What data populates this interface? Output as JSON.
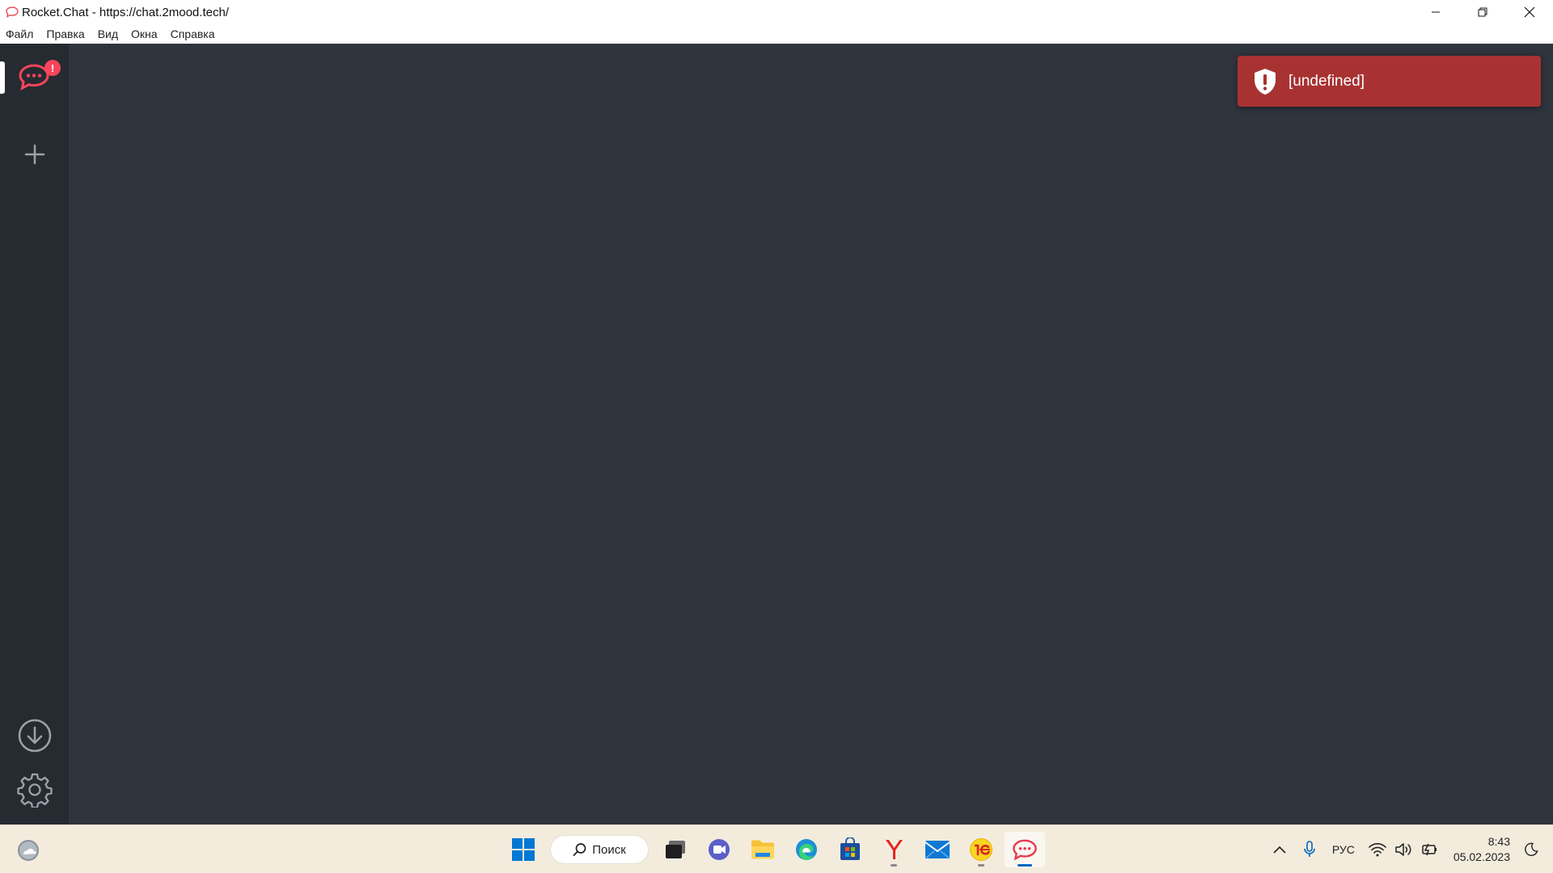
{
  "window": {
    "title": "Rocket.Chat - https://chat.2mood.tech/"
  },
  "menu": {
    "items": [
      "Файл",
      "Правка",
      "Вид",
      "Окна",
      "Справка"
    ]
  },
  "sidebar": {
    "server_badge": "!",
    "icons": [
      "rocketchat-server-icon",
      "plus-icon",
      "download-icon",
      "gear-icon"
    ]
  },
  "toast": {
    "message": "[undefined]",
    "color": "#a83232"
  },
  "taskbar": {
    "search_label": "Поиск",
    "language": "РУС",
    "time": "8:43",
    "date": "05.02.2023"
  },
  "colors": {
    "app_bg": "#2f343d",
    "rail_bg": "#262a31",
    "accent": "#f5455c",
    "taskbar_bg": "#f3ecdd"
  }
}
